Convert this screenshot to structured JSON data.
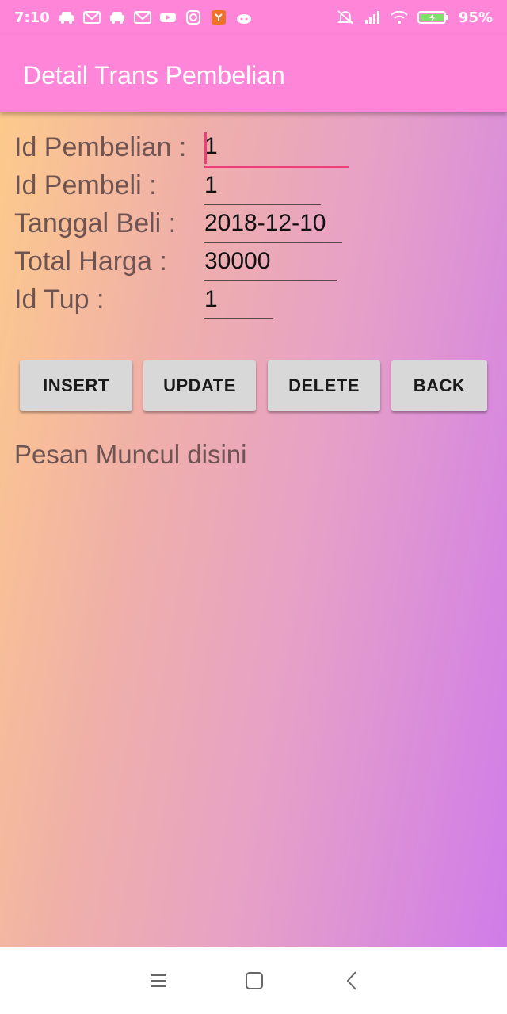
{
  "status_bar": {
    "time": "7:10",
    "battery": "95%",
    "notification_icons": [
      "car-icon",
      "gmail-icon",
      "car-icon",
      "gmail-icon",
      "youtube-icon",
      "instagram-icon",
      "app-icon",
      "bot-icon"
    ],
    "system_icons": [
      "mute-icon",
      "signal-icon",
      "wifi-icon",
      "battery-icon"
    ]
  },
  "toolbar": {
    "title": "Detail Trans Pembelian"
  },
  "form": {
    "fields": [
      {
        "label": "Id Pembelian :",
        "value": "1"
      },
      {
        "label": "Id Pembeli :",
        "value": "1"
      },
      {
        "label": "Tanggal Beli :",
        "value": "2018-12-10"
      },
      {
        "label": "Total Harga :",
        "value": "30000"
      },
      {
        "label": "Id Tup :",
        "value": "1"
      }
    ]
  },
  "buttons": {
    "insert": "INSERT",
    "update": "UPDATE",
    "delete": "DELETE",
    "back": "BACK"
  },
  "message": "Pesan Muncul disini",
  "colors": {
    "accent": "#ff85d9",
    "focus_underline": "#ef3d78",
    "label_text": "#6e5452"
  },
  "nav_bar": {
    "icons": [
      "menu-icon",
      "home-icon",
      "back-icon"
    ]
  }
}
